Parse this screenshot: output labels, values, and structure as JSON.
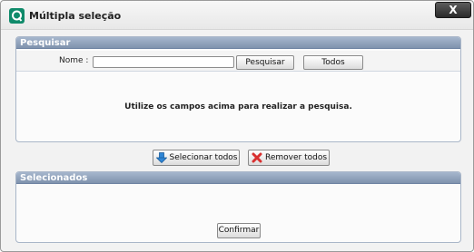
{
  "window": {
    "title": "Múltipla seleção",
    "close_label": "X",
    "icon": "app-logo-icon",
    "accent": "#0f8a6a"
  },
  "search_panel": {
    "header": "Pesquisar",
    "name_label": "Nome :",
    "name_value": "",
    "search_button": "Pesquisar",
    "all_button": "Todos",
    "info_message": "Utilize os campos acima para realizar a pesquisa."
  },
  "actions": {
    "select_all": "Selecionar todos",
    "select_all_icon": "arrow-down-icon",
    "remove_all": "Remover todos",
    "remove_all_icon": "red-x-icon"
  },
  "selected_panel": {
    "header": "Selecionados",
    "confirm_button": "Confirmar"
  },
  "colors": {
    "panel_header": "#8ea0bb",
    "select_icon": "#2f86d6",
    "remove_icon": "#d93030"
  }
}
